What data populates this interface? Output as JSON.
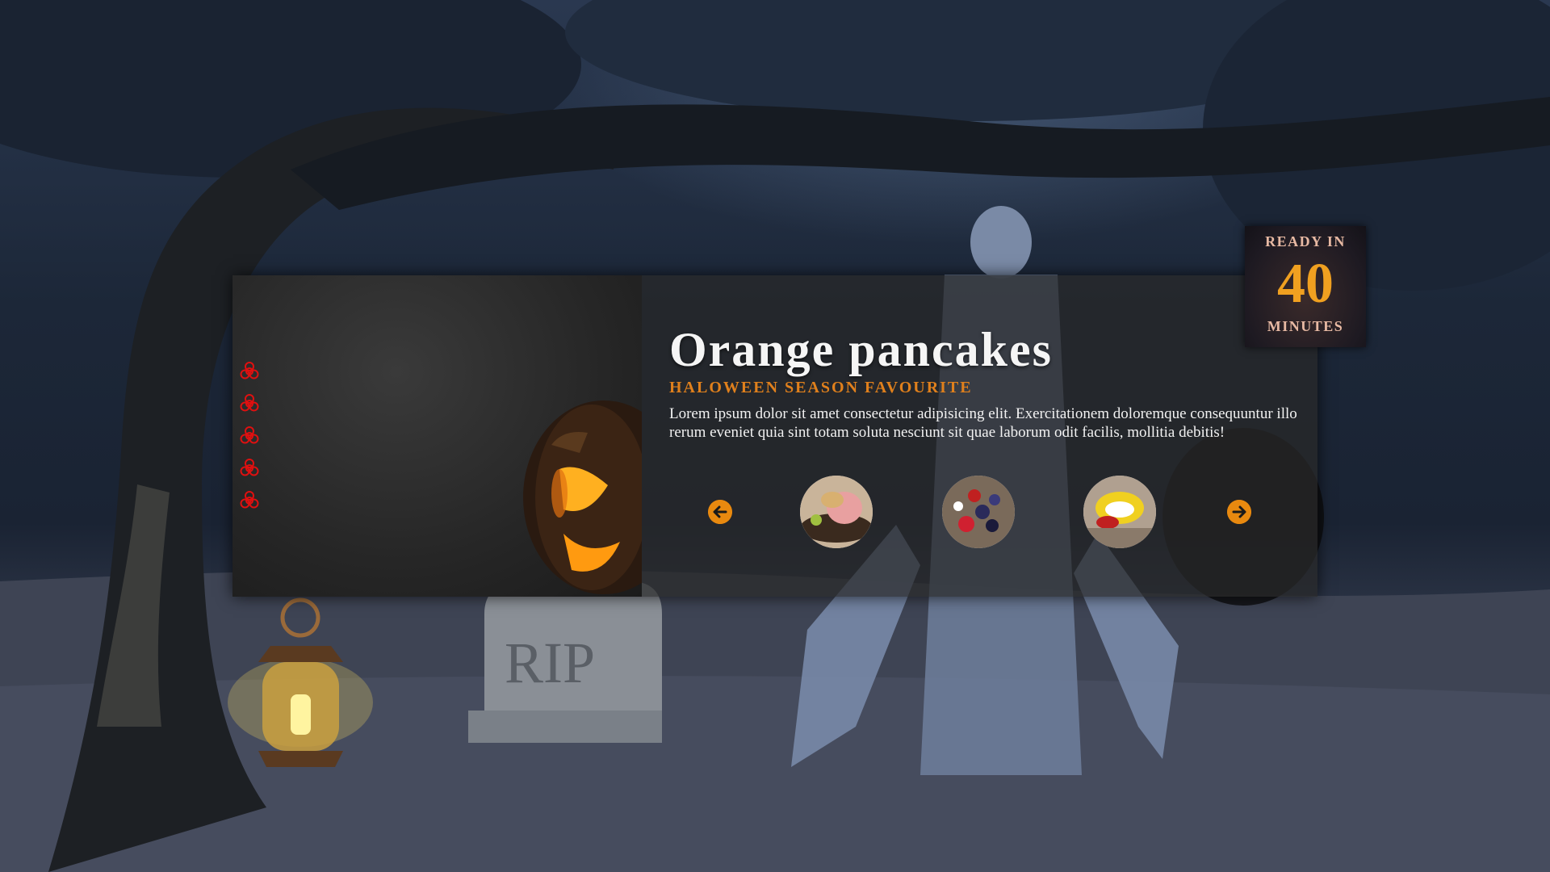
{
  "recipe": {
    "title": "Orange pancakes",
    "subtitle": "HALOWEEN SEASON FAVOURITE",
    "description": "Lorem ipsum dolor sit amet consectetur adipisicing elit. Exercitationem doloremque consequuntur illo rerum eveniet quia sint totam soluta nesciunt sit quae laborum odit facilis, mollitia debitis!"
  },
  "badge": {
    "top": "READY IN",
    "minutes": "40",
    "bottom": "MINUTES"
  },
  "nav": {
    "icon": "biohazard-icon",
    "count": 5
  },
  "carousel": {
    "prev_icon": "arrow-left-icon",
    "next_icon": "arrow-right-icon",
    "thumbnails": [
      "ham-plate-thumbnail",
      "berries-plate-thumbnail",
      "fruit-roll-thumbnail"
    ]
  },
  "colors": {
    "accent": "#e8890f",
    "subtitle": "#e0801c",
    "nav_icon": "#e01010",
    "badge_number": "#f0a020"
  }
}
